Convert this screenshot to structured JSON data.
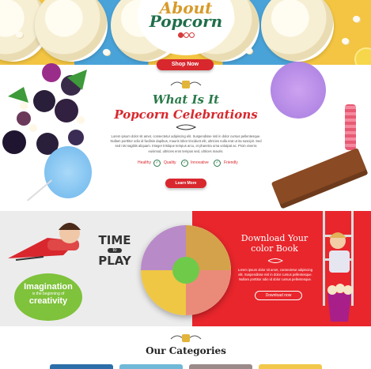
{
  "hero": {
    "title_line1": "About",
    "title_line2": "Popcorn",
    "button": "Shop Now",
    "pager": [
      "1",
      "2",
      "3"
    ]
  },
  "about": {
    "title_line1": "What Is It",
    "title_line2": "Popcorn Celebrations",
    "body": "Lorem ipsum dolor sit amet, consectetur adipiscing elit. Suspendisse nisl in dolor cursus pellentesque. Nullam porttitor odio id facilisis dapibus, mauris lobor tincidunt elit, ultricies nulla erat ut ita suscipit. Sed sed nisi sagittis aliquam. Integer tristique tempus arcu, et pharetra urna volutpat ac. Proin viverra euismod, ultricies eros tempus sed, ultrices mauris.",
    "features": [
      "Healthy",
      "Quality",
      "Innovative",
      "Friendly"
    ],
    "button": "Learn More"
  },
  "banner": {
    "time_line1": "TIME",
    "time_to": "to",
    "time_line2": "PLAY",
    "imagination_line1": "Imagination",
    "imagination_line2": "is the beginning of",
    "imagination_line3": "creativity",
    "download_title_line1": "Download Your",
    "download_title_line2": "color Book",
    "download_text": "Lorem ipsum dolor sit amet, consectetur adipiscing elit. Suspendisse nisl in dolor cursus pellentesque. Nullam porttitor odio id dolor cursus pellentesque.",
    "download_button": "Download now"
  },
  "categories": {
    "title": "Our Categories",
    "tile_colors": [
      "#2c6fa8",
      "#6fb8d8",
      "#9b8a8a",
      "#f1c84a"
    ]
  },
  "colors": {
    "accent_red": "#d8272d",
    "accent_green": "#2a7a4a",
    "hero_yellow": "#f3c542",
    "hero_blue": "#4aa3d8"
  }
}
